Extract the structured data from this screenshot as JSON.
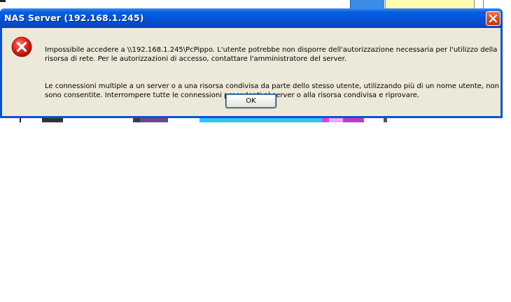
{
  "dialog": {
    "title": "NAS Server (192.168.1.245)",
    "close_icon": "close-x-icon",
    "message_icon": "error-icon",
    "message_line1": "Impossibile accedere a \\\\192.168.1.245\\PcPippo. L'utente potrebbe non disporre dell'autorizzazione necessaria per l'utilizzo della risorsa di rete. Per le autorizzazioni di accesso, contattare l'amministratore del server.",
    "message_line2": "Le connessioni multiple a un server o a una risorsa condivisa da parte dello stesso utente, utilizzando più di un nome utente, non sono consentite. Interrompere tutte le connessioni precedenti al server o alla risorsa condivisa e riprovare.",
    "ok_label": "OK"
  },
  "colors": {
    "titlebar": "#0554d7",
    "client": "#ece9d8",
    "close_button": "#d9481f",
    "error_red": "#d21b1b"
  }
}
